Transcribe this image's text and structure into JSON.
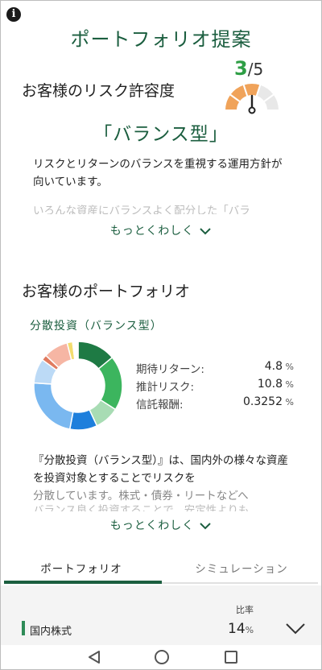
{
  "header": {
    "title": "ポートフォリオ提案"
  },
  "risk": {
    "heading": "お客様のリスク許容度",
    "level": 3,
    "max": 5,
    "level_text": "3",
    "max_text": "/5",
    "type_label": "「バランス型」",
    "description": "リスクとリターンのバランスを重視する運用方針が向いています。",
    "description_faded": "いろんな資産にバランスよく配分した「バラ",
    "more_label": "もっとくわしく"
  },
  "portfolio": {
    "heading": "お客様のポートフォリオ",
    "fund_name": "分散投資（バランス型）",
    "stats": [
      {
        "label": "期待リターン:",
        "value": "4.8",
        "unit": "%"
      },
      {
        "label": "推計リスク:",
        "value": "10.8",
        "unit": "%"
      },
      {
        "label": "信託報酬:",
        "value": "0.3252",
        "unit": "%"
      }
    ],
    "description": "『分散投資（バランス型）』は、国内外の様々な資産を投資対象とすることでリスクを",
    "description_light": "分散しています。株式・債券・リートなどへ",
    "description_faded": "バランス良く投資することで、安定性よりも",
    "more_label": "もっとくわしく"
  },
  "donut_data": {
    "segments": [
      {
        "value": 14,
        "color": "#1e7a44"
      },
      {
        "value": 20,
        "color": "#3cb55e"
      },
      {
        "value": 9,
        "color": "#a8dcb4"
      },
      {
        "value": 10,
        "color": "#1e7fdc"
      },
      {
        "value": 23,
        "color": "#7ab8f0"
      },
      {
        "value": 9,
        "color": "#bcdaf6"
      },
      {
        "value": 2,
        "color": "#e07a5f"
      },
      {
        "value": 9,
        "color": "#f6b6a4"
      },
      {
        "value": 2,
        "color": "#f2dc6e"
      },
      {
        "value": 2,
        "color": "#ffffff"
      }
    ]
  },
  "tabs": [
    {
      "label": "ポートフォリオ",
      "active": true
    },
    {
      "label": "シミュレーション",
      "active": false
    }
  ],
  "allocation": {
    "ratio_header": "比率",
    "items": [
      {
        "name": "国内株式",
        "value": "14",
        "unit": "%"
      }
    ]
  },
  "colors": {
    "accent": "#1b5e3f",
    "score": "#2e9e45",
    "gauge_fill": "#f0a35a",
    "gauge_empty": "#e8e8e8"
  },
  "icons": {
    "info": "info-icon",
    "chevron": "chevron-down-icon",
    "nav_back": "back-triangle-icon",
    "nav_home": "home-circle-icon",
    "nav_recents": "recents-square-icon"
  }
}
